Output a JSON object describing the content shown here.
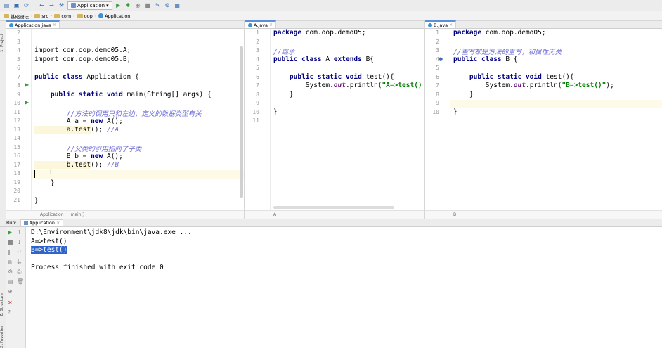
{
  "toolbar": {
    "run_config": "Application",
    "buttons": [
      "open-icon",
      "save-icon",
      "sync-icon",
      "back-icon",
      "forward-icon",
      "build-icon",
      "run-icon",
      "debug-icon",
      "coverage-icon",
      "stop-icon",
      "vcs-icon",
      "settings-icon",
      "structure-icon"
    ]
  },
  "breadcrumb": [
    "基础语法",
    "src",
    "com",
    "oop",
    "Application"
  ],
  "left_strip": {
    "project": "1: Project",
    "structure": "Z: Structure",
    "favorites": "2: Favorites"
  },
  "panes": [
    {
      "tab": "Application.java",
      "footer": [
        "Application",
        "main()"
      ],
      "lines": [
        "2",
        "3",
        "4",
        "5",
        "6",
        "7",
        "8",
        "9",
        "10",
        "11",
        "12",
        "13",
        "14",
        "15",
        "16",
        "17",
        "18",
        "19",
        "20",
        "21"
      ],
      "code": {
        "l4": "import com.oop.demo05.A;",
        "l5": "import com.oop.demo05.B;",
        "l7a": "public class",
        "l7b": " Application {",
        "l9a": "    public static void",
        "l9b": " main(String[] args) {",
        "l11": "        //方法的调用只和左边，定义的数据类型有关",
        "l12a": "        A a = ",
        "l12b": "new",
        "l12c": " A();",
        "l13a": "        a.test",
        "l13b": "(); ",
        "l13c": "//A",
        "l15": "        //父类的引用指向了子类",
        "l16a": "        B b = ",
        "l16b": "new",
        "l16c": " A();",
        "l17a": "        b.test",
        "l17b": "(); ",
        "l17c": "//B",
        "l19": "    }",
        "l21": "}"
      }
    },
    {
      "tab": "A.java",
      "footer": [
        "A"
      ],
      "lines": [
        "1",
        "2",
        "3",
        "4",
        "5",
        "6",
        "7",
        "8",
        "9",
        "10",
        "11"
      ],
      "code": {
        "l1a": "package",
        "l1b": " com.oop.demo05;",
        "l3": "//继承",
        "l4a": "public class",
        "l4b": " A ",
        "l4c": "extends",
        "l4d": " B{",
        "l6a": "    public static void",
        "l6b": " test(){",
        "l7a": "        System.",
        "l7b": "out",
        "l7c": ".println(",
        "l7d": "\"A=>test()\"",
        "l8": "    }",
        "l10": "}"
      }
    },
    {
      "tab": "B.java",
      "footer": [
        "B"
      ],
      "lines": [
        "1",
        "2",
        "3",
        "4",
        "5",
        "6",
        "7",
        "8",
        "9",
        "10"
      ],
      "code": {
        "l1a": "package",
        "l1b": " com.oop.demo05;",
        "l3": "//重写都是方法的重写，和属性无关",
        "l4a": "public class",
        "l4b": " B {",
        "l6a": "    public static void",
        "l6b": " test(){",
        "l7a": "        System.",
        "l7b": "out",
        "l7c": ".println(",
        "l7d": "\"B=>test()\"",
        "l7e": ");",
        "l8": "    }",
        "l10": "}"
      }
    }
  ],
  "run": {
    "label": "Run:",
    "tab": "Application",
    "console": [
      "D:\\Environment\\jdk8\\jdk\\bin\\java.exe ...",
      "A=>test()",
      "B=>test()",
      "",
      "Process finished with exit code 0"
    ]
  },
  "colors": {
    "keyword": "#000080",
    "comment": "#6b6bd6",
    "string": "#007f00",
    "selection": "#2f65ca"
  }
}
